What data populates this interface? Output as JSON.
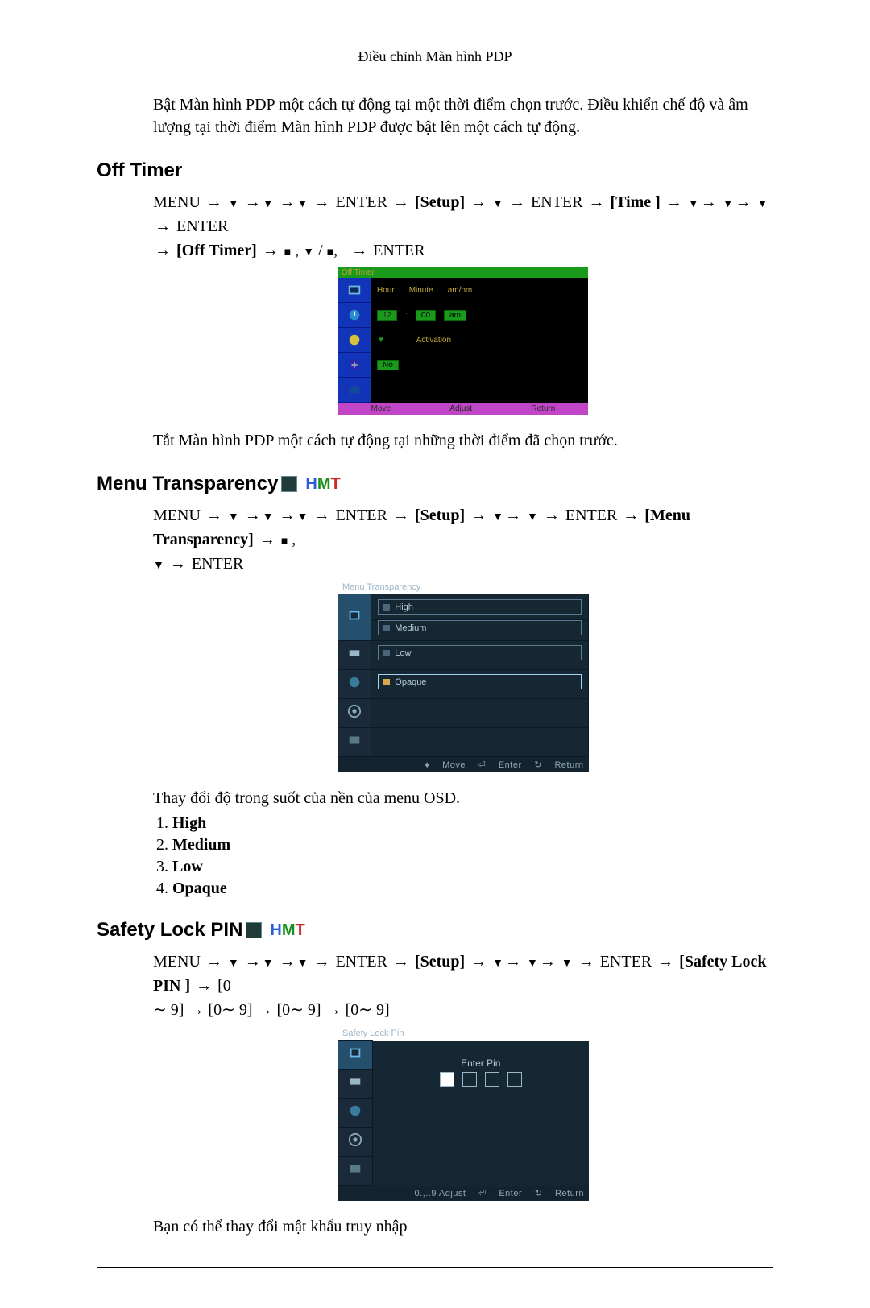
{
  "pageHeader": "Điều chỉnh Màn hình PDP",
  "intro": "Bật Màn hình PDP một cách tự động tại một thời điểm chọn trước. Điều khiển chế độ và âm lượng tại thời điểm Màn hình PDP được bật lên một cách tự động.",
  "sections": {
    "offTimer": {
      "title": "Off Timer",
      "path": {
        "menu": "MENU",
        "enter": "ENTER",
        "setup": "[Setup]",
        "time": "[Time ]",
        "offTimer": "[Off Timer]"
      },
      "osd": {
        "title": "Off Timer",
        "row1": {
          "labels": [
            "Hour",
            "Minute",
            "am/pm"
          ]
        },
        "row2": {
          "spins": [
            "12",
            "00",
            "am"
          ]
        },
        "row3": {
          "label": "Activation"
        },
        "row4": {
          "spin": "No"
        },
        "footer": [
          "Move",
          "Adjust",
          "Return"
        ]
      },
      "after": "Tắt Màn hình PDP một cách tự động tại những thời điểm đã chọn trước."
    },
    "menuTransparency": {
      "title": "Menu Transparency",
      "path": {
        "menu": "MENU",
        "enter": "ENTER",
        "setup": "[Setup]",
        "mt": "[Menu Transparency]"
      },
      "osd": {
        "title": "Menu Transparency",
        "options": [
          "High",
          "Medium",
          "Low",
          "Opaque"
        ],
        "selectedIndex": 3,
        "footer": {
          "move": "Move",
          "enter": "Enter",
          "return": "Return"
        }
      },
      "after": "Thay đổi độ trong suốt của nền của menu OSD.",
      "list": [
        "High",
        "Medium",
        "Low",
        "Opaque"
      ]
    },
    "safetyLock": {
      "title": "Safety Lock PIN",
      "path": {
        "menu": "MENU",
        "enter": "ENTER",
        "setup": "[Setup]",
        "sl": "[Safety Lock PIN ]",
        "range": "[0∼ 9] → [0∼ 9] → [0∼ 9] → [0∼ 9]"
      },
      "osd": {
        "title": "Safety Lock Pin",
        "prompt": "Enter Pin",
        "digits": 4,
        "footer": {
          "adjust": "0.,..9 Adjust",
          "enter": "Enter",
          "return": "Return"
        }
      },
      "after": "Bạn có thể thay đổi mật khẩu truy nhập"
    }
  },
  "iconBadges": {
    "hmt": {
      "h": "H",
      "m": "M",
      "t": "T"
    }
  }
}
